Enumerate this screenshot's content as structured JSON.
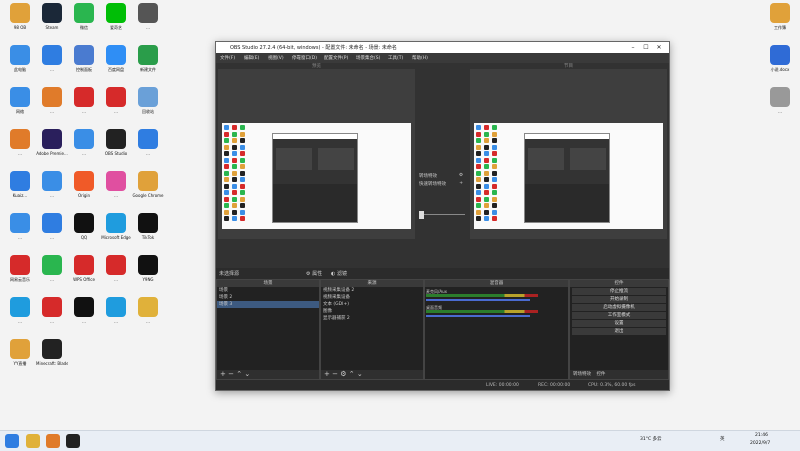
{
  "desktop": {
    "icons": [
      {
        "label": "98 OB",
        "icon": "user-icon",
        "color": "#e0a13a"
      },
      {
        "label": "Steam",
        "icon": "steam-icon",
        "color": "#1b2838"
      },
      {
        "label": "微信",
        "icon": "wechat-icon",
        "color": "#2ab64f"
      },
      {
        "label": "爱奇艺",
        "icon": "iqiyi-icon",
        "color": "#00be06"
      },
      {
        "label": "…",
        "icon": "app-icon",
        "color": "#555"
      },
      {
        "label": "此电脑",
        "icon": "computer-icon",
        "color": "#3a8ee6"
      },
      {
        "label": "…",
        "icon": "shield-icon",
        "color": "#2f7de1"
      },
      {
        "label": "控制面板",
        "icon": "control-panel-icon",
        "color": "#4a7bd0"
      },
      {
        "label": "百度网盘",
        "icon": "cloud-icon",
        "color": "#2f8ef5"
      },
      {
        "label": "新建文件",
        "icon": "file-icon",
        "color": "#2a9d4a"
      },
      {
        "label": "网络",
        "icon": "network-icon",
        "color": "#3a8ee6"
      },
      {
        "label": "…",
        "icon": "app-icon",
        "color": "#e07b2a"
      },
      {
        "label": "…",
        "icon": "app-icon",
        "color": "#d62a2a"
      },
      {
        "label": "…",
        "icon": "app-icon",
        "color": "#d62a2a"
      },
      {
        "label": "回收站",
        "icon": "recycle-bin-icon",
        "color": "#6aa0d8"
      },
      {
        "label": "…",
        "icon": "app-icon",
        "color": "#e07b2a"
      },
      {
        "label": "Adobe Premie...",
        "icon": "premiere-icon",
        "color": "#2a1f5c"
      },
      {
        "label": "…",
        "icon": "app-icon",
        "color": "#3a8ee6"
      },
      {
        "label": "OBS Studio",
        "icon": "obs-icon",
        "color": "#222"
      },
      {
        "label": "…",
        "icon": "app-icon",
        "color": "#2f7de1"
      },
      {
        "label": "Kuaiz…",
        "icon": "app-icon",
        "color": "#2f7de1"
      },
      {
        "label": "…",
        "icon": "app-icon",
        "color": "#3a8ee6"
      },
      {
        "label": "Origin",
        "icon": "origin-icon",
        "color": "#f05a28"
      },
      {
        "label": "…",
        "icon": "app-icon",
        "color": "#e04fa0"
      },
      {
        "label": "Google Chrome",
        "icon": "chrome-icon",
        "color": "#e0a13a"
      },
      {
        "label": "…",
        "icon": "app-icon",
        "color": "#3a8ee6"
      },
      {
        "label": "…",
        "icon": "app-icon",
        "color": "#2f7de1"
      },
      {
        "label": "QQ",
        "icon": "qq-icon",
        "color": "#111"
      },
      {
        "label": "Microsoft Edge",
        "icon": "edge-icon",
        "color": "#1f9cde"
      },
      {
        "label": "TikTok",
        "icon": "tiktok-icon",
        "color": "#111"
      },
      {
        "label": "网易云音乐",
        "icon": "music-icon",
        "color": "#d62a2a"
      },
      {
        "label": "…",
        "icon": "app-icon",
        "color": "#2ab64f"
      },
      {
        "label": "WPS Office",
        "icon": "wps-icon",
        "color": "#d62a2a"
      },
      {
        "label": "…",
        "icon": "app-icon",
        "color": "#d62a2a"
      },
      {
        "label": "Y9NG",
        "icon": "app-icon",
        "color": "#111"
      },
      {
        "label": "…",
        "icon": "app-icon",
        "color": "#1f9cde"
      },
      {
        "label": "…",
        "icon": "app-icon",
        "color": "#d62a2a"
      },
      {
        "label": "…",
        "icon": "app-icon",
        "color": "#111"
      },
      {
        "label": "…",
        "icon": "ie-icon",
        "color": "#1f9cde"
      },
      {
        "label": "…",
        "icon": "folder-icon",
        "color": "#e0b13a"
      },
      {
        "label": "YY直播",
        "icon": "app-icon",
        "color": "#e0a13a"
      },
      {
        "label": "Minecraft: Blade…",
        "icon": "app-icon",
        "color": "#222"
      },
      {
        "label": "工作簿",
        "icon": "doc-icon",
        "color": "#e0a13a"
      },
      {
        "label": "小说.docx",
        "icon": "word-icon",
        "color": "#2f6bd6"
      },
      {
        "label": "…",
        "icon": "file-icon",
        "color": "#999"
      }
    ]
  },
  "obs": {
    "title": "OBS Studio 27.2.4 (64-bit, windows) - 配置文件: 未命名 - 场景: 未命名",
    "menu": [
      "文件(F)",
      "编辑(E)",
      "视图(V)",
      "停靠窗口(D)",
      "配置文件(P)",
      "场景集合(S)",
      "工具(T)",
      "帮助(H)"
    ],
    "preview_label": "预览",
    "program_label": "节目",
    "transition_label": "转场特效",
    "quick_transition": "快速转场特效",
    "scene_bar": "未选择源",
    "scene_bar_props": "属性",
    "scene_bar_filters": "滤镜",
    "scenes_header": "场景",
    "scenes": [
      "场景",
      "场景 2",
      "场景 3"
    ],
    "sources_header": "来源",
    "sources": [
      "视频采集设备 2",
      "视频采集设备",
      "文本 (GDI+)",
      "图像",
      "显示器捕获 2"
    ],
    "mixer_header": "混音器",
    "mixer": [
      {
        "name": "麦克风/Aux"
      },
      {
        "name": "桌面音频"
      }
    ],
    "controls_header": "控件",
    "controls": [
      "停止推流",
      "开始录制",
      "启动虚拟摄像机",
      "工作室模式",
      "设置",
      "退出"
    ],
    "transition_dock": [
      "转场特效",
      "控件"
    ],
    "status": {
      "live": "LIVE: 00:00:00",
      "rec": "REC: 00:00:00",
      "cpu": "CPU: 0.3%, 60.00 fps"
    }
  },
  "taskbar": {
    "weather": "31°C 多云",
    "lang": "英",
    "time": "21:46",
    "date": "2022/9/7"
  }
}
